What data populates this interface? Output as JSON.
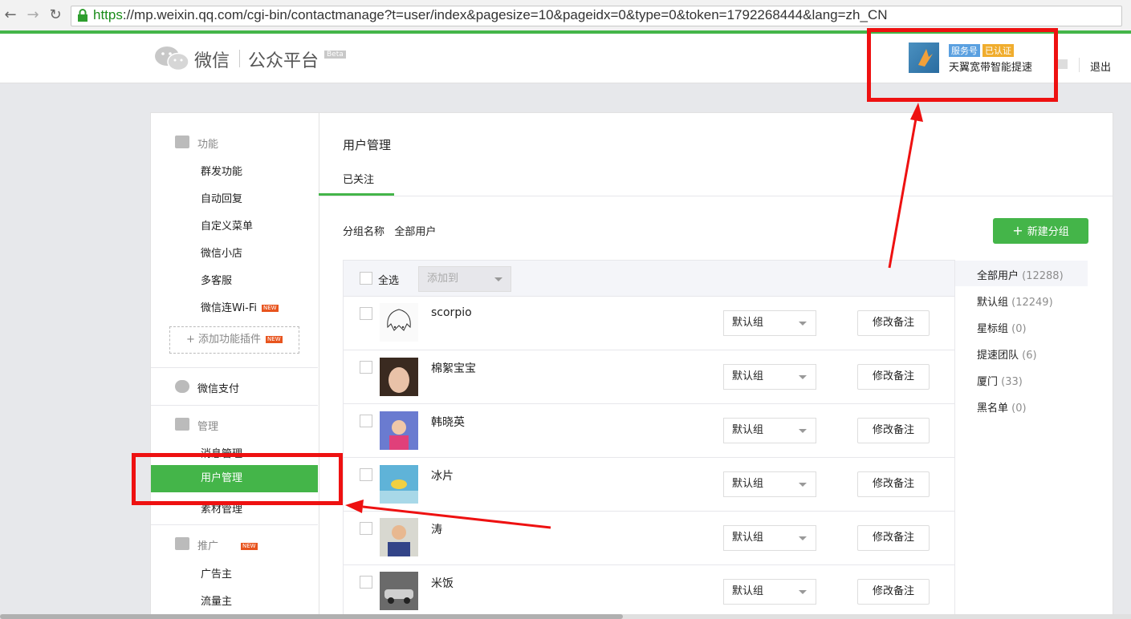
{
  "browser": {
    "url_scheme": "https",
    "url_rest": "://mp.weixin.qq.com/cgi-bin/contactmanage?t=user/index&pagesize=10&pageidx=0&type=0&token=1792268444&lang=zh_CN"
  },
  "header": {
    "logo_wechat": "微信",
    "logo_platform": "公众平台",
    "logo_beta": "Beta",
    "badge_service": "服务号",
    "badge_verified": "已认证",
    "account_name": "天翼宽带智能提速",
    "logout": "退出"
  },
  "sidebar": {
    "section_features": "功能",
    "features": [
      "群发功能",
      "自动回复",
      "自定义菜单",
      "微信小店",
      "多客服",
      "微信连Wi-Fi"
    ],
    "new_tag": "NEW",
    "add_plugin": "添加功能插件",
    "section_pay": "微信支付",
    "section_manage": "管理",
    "manage": [
      "消息管理",
      "用户管理",
      "素材管理"
    ],
    "section_promo": "推广",
    "promo": [
      "广告主",
      "流量主"
    ]
  },
  "main": {
    "page_title": "用户管理",
    "tab_followed": "已关注",
    "group_name_label": "分组名称",
    "group_name_value": "全部用户",
    "new_group_button": "新建分组",
    "select_all": "全选",
    "add_to": "添加到",
    "group_default": "默认组",
    "remark_button": "修改备注",
    "users": [
      {
        "name": "scorpio"
      },
      {
        "name": "棉絮宝宝"
      },
      {
        "name": "韩晓英"
      },
      {
        "name": "冰片"
      },
      {
        "name": "涛"
      },
      {
        "name": "米饭"
      }
    ]
  },
  "groups": [
    {
      "name": "全部用户",
      "count": "(12288)"
    },
    {
      "name": "默认组",
      "count": "(12249)"
    },
    {
      "name": "星标组",
      "count": "(0)"
    },
    {
      "name": "提速团队",
      "count": "(6)"
    },
    {
      "name": "厦门",
      "count": "(33)"
    },
    {
      "name": "黑名单",
      "count": "(0)"
    }
  ],
  "colors": {
    "accent": "#44b549",
    "annotation_red": "#ee1111"
  }
}
